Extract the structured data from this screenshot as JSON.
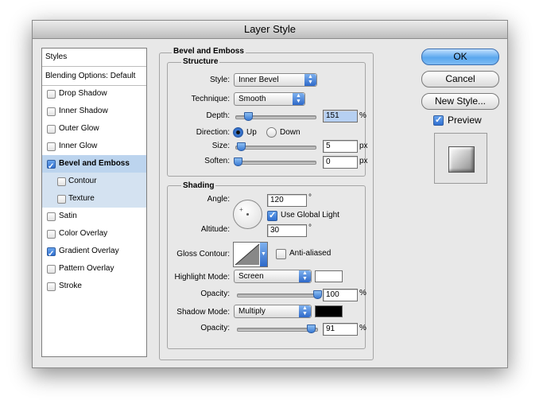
{
  "window": {
    "title": "Layer Style"
  },
  "sidebar": {
    "header": "Styles",
    "blending": "Blending Options: Default",
    "items": [
      {
        "label": "Drop Shadow",
        "checked": false
      },
      {
        "label": "Inner Shadow",
        "checked": false
      },
      {
        "label": "Outer Glow",
        "checked": false
      },
      {
        "label": "Inner Glow",
        "checked": false
      },
      {
        "label": "Bevel and Emboss",
        "checked": true,
        "selected": true
      },
      {
        "label": "Contour",
        "checked": false,
        "sub": true
      },
      {
        "label": "Texture",
        "checked": false,
        "sub": true
      },
      {
        "label": "Satin",
        "checked": false
      },
      {
        "label": "Color Overlay",
        "checked": false
      },
      {
        "label": "Gradient Overlay",
        "checked": true
      },
      {
        "label": "Pattern Overlay",
        "checked": false
      },
      {
        "label": "Stroke",
        "checked": false
      }
    ]
  },
  "bevel": {
    "title": "Bevel and Emboss",
    "structure": {
      "title": "Structure",
      "style_label": "Style:",
      "style_value": "Inner Bevel",
      "technique_label": "Technique:",
      "technique_value": "Smooth",
      "depth_label": "Depth:",
      "depth_value": "151",
      "depth_unit": "%",
      "depth_fraction": 0.15,
      "direction_label": "Direction:",
      "direction_up": "Up",
      "direction_down": "Down",
      "direction_selected": "Up",
      "size_label": "Size:",
      "size_value": "5",
      "size_unit": "px",
      "size_fraction": 0.02,
      "soften_label": "Soften:",
      "soften_value": "0",
      "soften_unit": "px",
      "soften_fraction": 0.0
    },
    "shading": {
      "title": "Shading",
      "angle_label": "Angle:",
      "angle_value": "120",
      "angle_unit": "°",
      "global_light_label": "Use Global Light",
      "global_light_checked": true,
      "altitude_label": "Altitude:",
      "altitude_value": "30",
      "altitude_unit": "°",
      "gloss_label": "Gloss Contour:",
      "anti_aliased_label": "Anti-aliased",
      "anti_aliased_checked": false,
      "highlight_label": "Highlight Mode:",
      "highlight_value": "Screen",
      "highlight_color": "#ffffff",
      "hopacity_label": "Opacity:",
      "hopacity_value": "100",
      "hopacity_unit": "%",
      "hopacity_fraction": 1.0,
      "shadow_label": "Shadow Mode:",
      "shadow_value": "Multiply",
      "shadow_color": "#000000",
      "sopacity_label": "Opacity:",
      "sopacity_value": "91",
      "sopacity_unit": "%",
      "sopacity_fraction": 0.91
    }
  },
  "buttons": {
    "ok": "OK",
    "cancel": "Cancel",
    "new_style": "New Style...",
    "preview": "Preview",
    "preview_checked": true
  }
}
